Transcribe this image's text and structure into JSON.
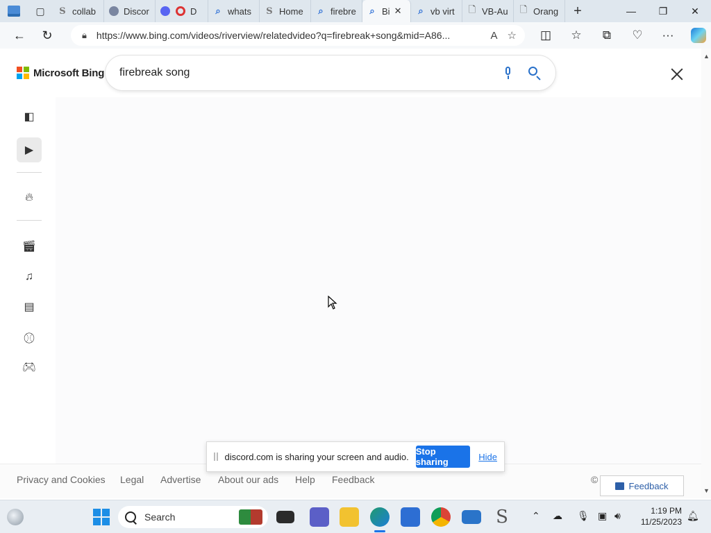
{
  "browser": {
    "tabs": [
      {
        "title": "collab",
        "icon": "s-icon"
      },
      {
        "title": "Discor",
        "icon": "discord-icon"
      },
      {
        "title": "D",
        "icon": "discord-icon"
      },
      {
        "title": "whats",
        "icon": "search-icon"
      },
      {
        "title": "Home",
        "icon": "s-icon"
      },
      {
        "title": "firebre",
        "icon": "search-icon"
      },
      {
        "title": "Bi",
        "icon": "search-icon",
        "active": true
      },
      {
        "title": "vb virt",
        "icon": "search-icon"
      },
      {
        "title": "VB-Au",
        "icon": "document-icon"
      },
      {
        "title": "Orang",
        "icon": "document-icon"
      }
    ],
    "url": "https://www.bing.com/videos/riverview/relatedvideo?q=firebreak+song&mid=A86..."
  },
  "bing": {
    "logo_text": "Microsoft Bing",
    "logo_colors": [
      "#f25022",
      "#7fba00",
      "#00a4ef",
      "#ffb900"
    ],
    "search_value": "firebreak song",
    "sidebar_icons": [
      "sidebar-panel-icon",
      "video-icon",
      "flame-icon",
      "clapperboard-icon",
      "music-note-icon",
      "news-icon",
      "sports-ball-icon",
      "gamepad-icon"
    ]
  },
  "footer": {
    "links": [
      "Privacy and Cookies",
      "Legal",
      "Advertise",
      "About our ads",
      "Help",
      "Feedback"
    ],
    "copyright": "©",
    "feedback_button": "Feedback"
  },
  "share_notification": {
    "message": "discord.com is sharing your screen and audio.",
    "stop_label": "Stop sharing",
    "hide_label": "Hide"
  },
  "taskbar": {
    "search_placeholder": "Search",
    "time": "1:19 PM",
    "date": "11/25/2023"
  },
  "colors": {
    "accent": "#1a73e8",
    "bing_blue": "#2870c9"
  }
}
